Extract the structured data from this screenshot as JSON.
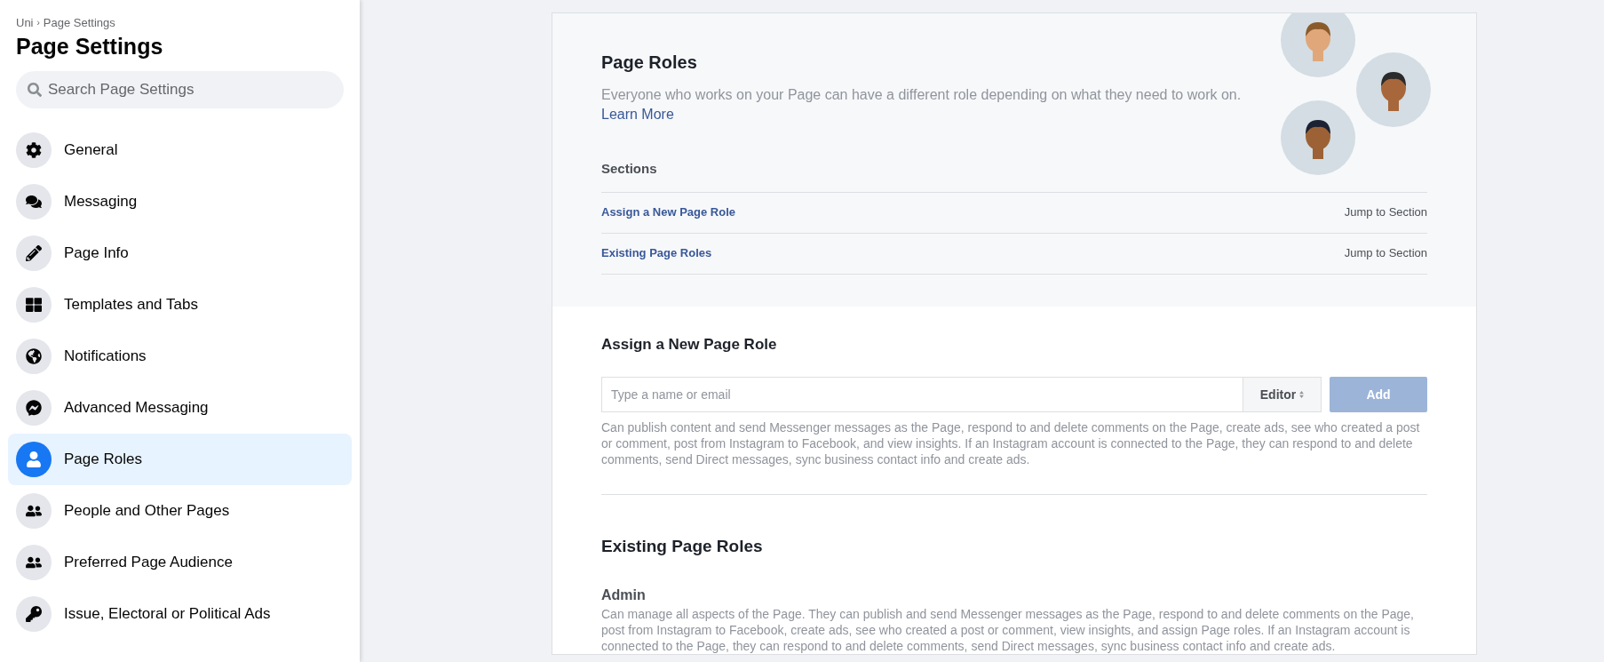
{
  "sidebar": {
    "breadcrumb": {
      "parent": "Uni",
      "separator": "›",
      "current": "Page Settings"
    },
    "title": "Page Settings",
    "search": {
      "placeholder": "Search Page Settings"
    },
    "items": [
      {
        "label": "General",
        "selected": false
      },
      {
        "label": "Messaging",
        "selected": false
      },
      {
        "label": "Page Info",
        "selected": false
      },
      {
        "label": "Templates and Tabs",
        "selected": false
      },
      {
        "label": "Notifications",
        "selected": false
      },
      {
        "label": "Advanced Messaging",
        "selected": false
      },
      {
        "label": "Page Roles",
        "selected": true
      },
      {
        "label": "People and Other Pages",
        "selected": false
      },
      {
        "label": "Preferred Page Audience",
        "selected": false
      },
      {
        "label": "Issue, Electoral or Political Ads",
        "selected": false
      }
    ]
  },
  "header": {
    "title": "Page Roles",
    "description": "Everyone who works on your Page can have a different role depending on what they need to work on.",
    "learn_more": "Learn More",
    "sections_title": "Sections",
    "sections": [
      {
        "label": "Assign a New Page Role",
        "jump": "Jump to Section"
      },
      {
        "label": "Existing Page Roles",
        "jump": "Jump to Section"
      }
    ]
  },
  "assign": {
    "title": "Assign a New Page Role",
    "input": {
      "placeholder": "Type a name or email"
    },
    "role": "Editor",
    "add_button": {
      "label": "Add",
      "disabled": true
    },
    "description": "Can publish content and send Messenger messages as the Page, respond to and delete comments on the Page, create ads, see who created a post or comment, post from Instagram to Facebook, and view insights. If an Instagram account is connected to the Page, they can respond to and delete comments, send Direct messages, sync business contact info and create ads."
  },
  "existing": {
    "title": "Existing Page Roles",
    "roles": [
      {
        "name": "Admin",
        "description": "Can manage all aspects of the Page. They can publish and send Messenger messages as the Page, respond to and delete comments on the Page, post from Instagram to Facebook, create ads, see who created a post or comment, view insights, and assign Page roles. If an Instagram account is connected to the Page, they can respond to and delete comments, send Direct messages, sync business contact info and create ads."
      }
    ]
  }
}
